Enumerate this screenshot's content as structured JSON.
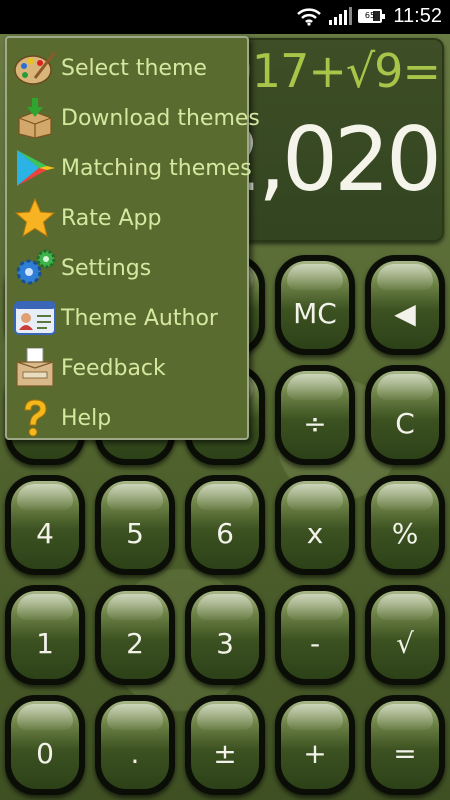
{
  "status_bar": {
    "time": "11:52",
    "battery_level": "65",
    "icons": [
      "wifi-icon",
      "signal-icon",
      "battery-icon"
    ]
  },
  "display": {
    "expression": "2017+√9=",
    "result": "2,020"
  },
  "menu": {
    "items": [
      {
        "label": "Select theme",
        "icon": "palette-icon"
      },
      {
        "label": "Download themes",
        "icon": "download-box-icon"
      },
      {
        "label": "Matching themes",
        "icon": "play-store-icon"
      },
      {
        "label": "Rate App",
        "icon": "star-icon"
      },
      {
        "label": "Settings",
        "icon": "gears-icon"
      },
      {
        "label": "Theme Author",
        "icon": "id-card-icon"
      },
      {
        "label": "Feedback",
        "icon": "feedback-box-icon"
      },
      {
        "label": "Help",
        "icon": "question-mark-icon"
      }
    ]
  },
  "keypad": {
    "row2": [
      "MC",
      "◀"
    ],
    "row3": [
      "÷",
      "C"
    ],
    "row4": [
      "4",
      "5",
      "6",
      "x",
      "%"
    ],
    "row5": [
      "1",
      "2",
      "3",
      "-",
      "√"
    ],
    "row6": [
      "0",
      ".",
      "±",
      "+",
      "="
    ]
  },
  "colors": {
    "menu_text": "#d5e8a0",
    "expression_text": "#a8c54a",
    "result_text": "#f4f4ea",
    "menu_bg": "#596b2f"
  }
}
